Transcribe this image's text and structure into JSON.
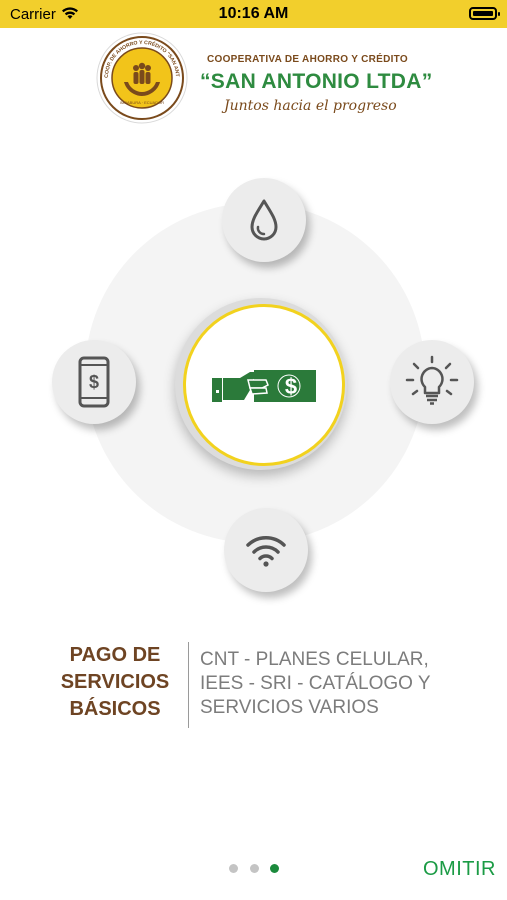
{
  "status_bar": {
    "carrier": "Carrier",
    "time": "10:16 AM"
  },
  "header": {
    "coop_line1": "COOPERATIVA DE AHORRO Y CRÉDITO",
    "coop_name": "“SAN ANTONIO LTDA”",
    "slogan": "Juntos hacia el progreso",
    "seal_text": "COOP. DE AHORRO Y CRÉDITO \"SAN ANTONIO LTDA\" · IMBABURA · ECUADOR"
  },
  "services": {
    "top": "water-drop-icon",
    "left": "mobile-payment-icon",
    "right": "light-bulb-icon",
    "bottom": "wifi-icon",
    "center": "hand-cash-payment-icon"
  },
  "content": {
    "title_lines": [
      "PAGO DE",
      "SERVICIOS",
      "BÁSICOS"
    ],
    "description_lines": [
      "CNT - PLANES CELULAR,",
      "IEES - SRI - CATÁLOGO Y",
      "SERVICIOS VARIOS"
    ]
  },
  "pager": {
    "total": 3,
    "active_index": 2
  },
  "skip_label": "OMITIR",
  "colors": {
    "status_bar": "#f2cf2c",
    "brand_green": "#2e8b40",
    "brand_brown": "#6e4423",
    "accent_yellow": "#f2d21e"
  }
}
